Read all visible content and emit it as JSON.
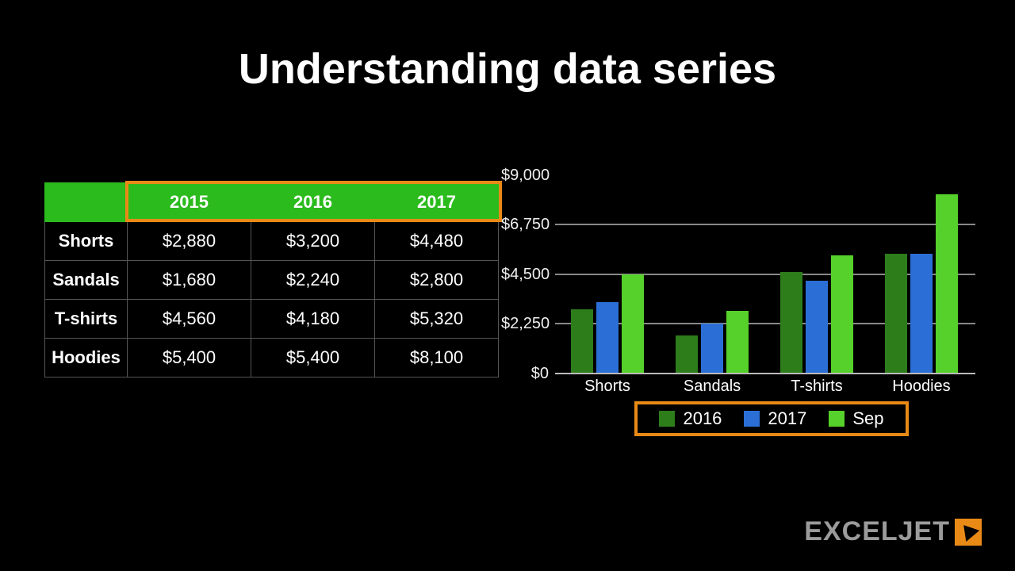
{
  "title": "Understanding data series",
  "table": {
    "headers": {
      "c1": "2015",
      "c2": "2016",
      "c3": "2017"
    },
    "rows": [
      {
        "name": "Shorts",
        "c1": "$2,880",
        "c2": "$3,200",
        "c3": "$4,480"
      },
      {
        "name": "Sandals",
        "c1": "$1,680",
        "c2": "$2,240",
        "c3": "$2,800"
      },
      {
        "name": "T-shirts",
        "c1": "$4,560",
        "c2": "$4,180",
        "c3": "$5,320"
      },
      {
        "name": "Hoodies",
        "c1": "$5,400",
        "c2": "$5,400",
        "c3": "$8,100"
      }
    ]
  },
  "yticks": {
    "t0": "$0",
    "t1": "$2,250",
    "t2": "$4,500",
    "t3": "$6,750",
    "t4": "$9,000"
  },
  "legend": {
    "s1": "2016",
    "s2": "2017",
    "s3": "Sep"
  },
  "categories": {
    "c0": "Shorts",
    "c1": "Sandals",
    "c2": "T-shirts",
    "c3": "Hoodies"
  },
  "logo": "EXCELJET",
  "chart_data": {
    "type": "bar",
    "title": "",
    "xlabel": "",
    "ylabel": "",
    "ylim": [
      0,
      9000
    ],
    "yticks": [
      0,
      2250,
      4500,
      6750,
      9000
    ],
    "categories": [
      "Shorts",
      "Sandals",
      "T-shirts",
      "Hoodies"
    ],
    "series": [
      {
        "name": "2016",
        "color": "#2d7d1a",
        "values": [
          2880,
          1680,
          4560,
          5400
        ]
      },
      {
        "name": "2017",
        "color": "#2b6fd6",
        "values": [
          3200,
          2240,
          4180,
          5400
        ]
      },
      {
        "name": "Sep",
        "color": "#56d02a",
        "values": [
          4480,
          2800,
          5320,
          8100
        ]
      }
    ],
    "legend_position": "bottom",
    "grid": true
  }
}
